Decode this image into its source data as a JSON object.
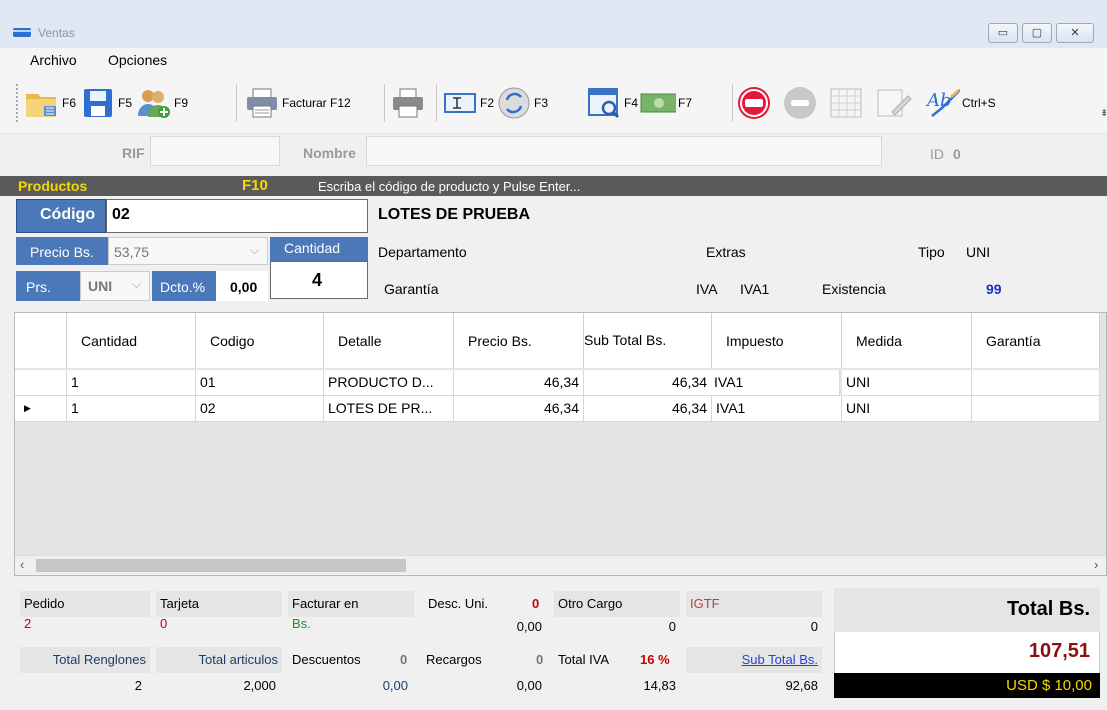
{
  "window": {
    "title": "Ventas",
    "min": "▭",
    "max": "▢",
    "close": "✕"
  },
  "menu": [
    "Archivo",
    "Opciones"
  ],
  "toolbar": {
    "f6": "F6",
    "f5": "F5",
    "f9": "F9",
    "facturar": "Facturar F12",
    "f2": "F2",
    "f3": "F3",
    "f4": "F4",
    "f7": "F7",
    "ctrls": "Ctrl+S"
  },
  "client": {
    "rif_label": "RIF",
    "nombre_label": "Nombre",
    "id_label": "ID",
    "id_value": "0"
  },
  "productos": {
    "label": "Productos",
    "key": "F10",
    "hint": "Escriba el código de producto y Pulse Enter..."
  },
  "product": {
    "codigo_label": "Código",
    "codigo_value": "02",
    "name": "LOTES DE PRUEBA",
    "precio_label": "Precio Bs.",
    "precio_value": "53,75",
    "cantidad_label": "Cantidad",
    "cantidad_value": "4",
    "prs_label": "Prs.",
    "prs_value": "UNI",
    "dcto_label": "Dcto.%",
    "dcto_value": "0,00",
    "departamento_label": "Departamento",
    "extras_label": "Extras",
    "tipo_label": "Tipo",
    "tipo_value": "UNI",
    "garantia_label": "Garantía",
    "iva_label": "IVA",
    "iva_value": "IVA1",
    "existencia_label": "Existencia",
    "existencia_value": "99"
  },
  "grid": {
    "headers": [
      "Cantidad",
      "Codigo",
      "Detalle",
      "Precio Bs.",
      "Sub Total Bs.",
      "Impuesto",
      "Medida",
      "Garantía"
    ],
    "rows": [
      {
        "cantidad": "1",
        "codigo": "01",
        "detalle": "PRODUCTO D...",
        "precio": "46,34",
        "subtotal": "46,34",
        "impuesto": "IVA1",
        "medida": "UNI",
        "garantia": ""
      },
      {
        "cantidad": "1",
        "codigo": "02",
        "detalle": "LOTES DE PR...",
        "precio": "46,34",
        "subtotal": "46,34",
        "impuesto": "IVA1",
        "medida": "UNI",
        "garantia": ""
      }
    ]
  },
  "footer": {
    "pedido_label": "Pedido",
    "pedido_value": "2",
    "tarjeta_label": "Tarjeta",
    "tarjeta_value": "0",
    "facturar_label": "Facturar en",
    "facturar_value": "Bs.",
    "desc_uni_label": "Desc. Uni.",
    "desc_uni_count": "0",
    "desc_uni_value": "0,00",
    "otro_cargo_label": "Otro Cargo",
    "otro_cargo_value": "0",
    "igtf_label": "IGTF",
    "igtf_value": "0",
    "total_renglones_label": "Total Renglones",
    "total_renglones_value": "2",
    "total_articulos_label": "Total articulos",
    "total_articulos_value": "2,000",
    "descuentos_label": "Descuentos",
    "descuentos_count": "0",
    "descuentos_value": "0,00",
    "recargos_label": "Recargos",
    "recargos_count": "0",
    "recargos_value": "0,00",
    "total_iva_label": "Total IVA",
    "total_iva_pct": "16 %",
    "total_iva_value": "14,83",
    "subtotal_label": "Sub Total Bs.",
    "subtotal_value": "92,68",
    "total_label": "Total Bs.",
    "total_value": "107,51",
    "usd_value": "USD $ 10,00"
  },
  "colors": {
    "accent_blue": "#4a78b8",
    "dark_blue": "#1c3d6b",
    "red": "#cc0000",
    "green": "#2a8a2a",
    "yellow": "#f5d800"
  }
}
